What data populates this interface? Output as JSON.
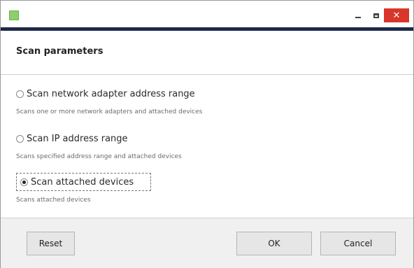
{
  "window": {
    "app_icon": "app-icon",
    "controls": {
      "minimize": "minimize-icon",
      "maximize": "maximize-icon",
      "close_glyph": "✕"
    },
    "accent_color": "#1e2a4a",
    "close_color": "#d9362b"
  },
  "header": {
    "title": "Scan parameters"
  },
  "options": [
    {
      "label": "Scan network adapter address range",
      "description": "Scans one or more network adapters and attached devices",
      "selected": false
    },
    {
      "label": "Scan IP address range",
      "description": "Scans specified address range and attached devices",
      "selected": false
    },
    {
      "label": "Scan attached devices",
      "description": "Scans attached devices",
      "selected": true
    }
  ],
  "footer": {
    "reset_label": "Reset",
    "ok_label": "OK",
    "cancel_label": "Cancel"
  }
}
